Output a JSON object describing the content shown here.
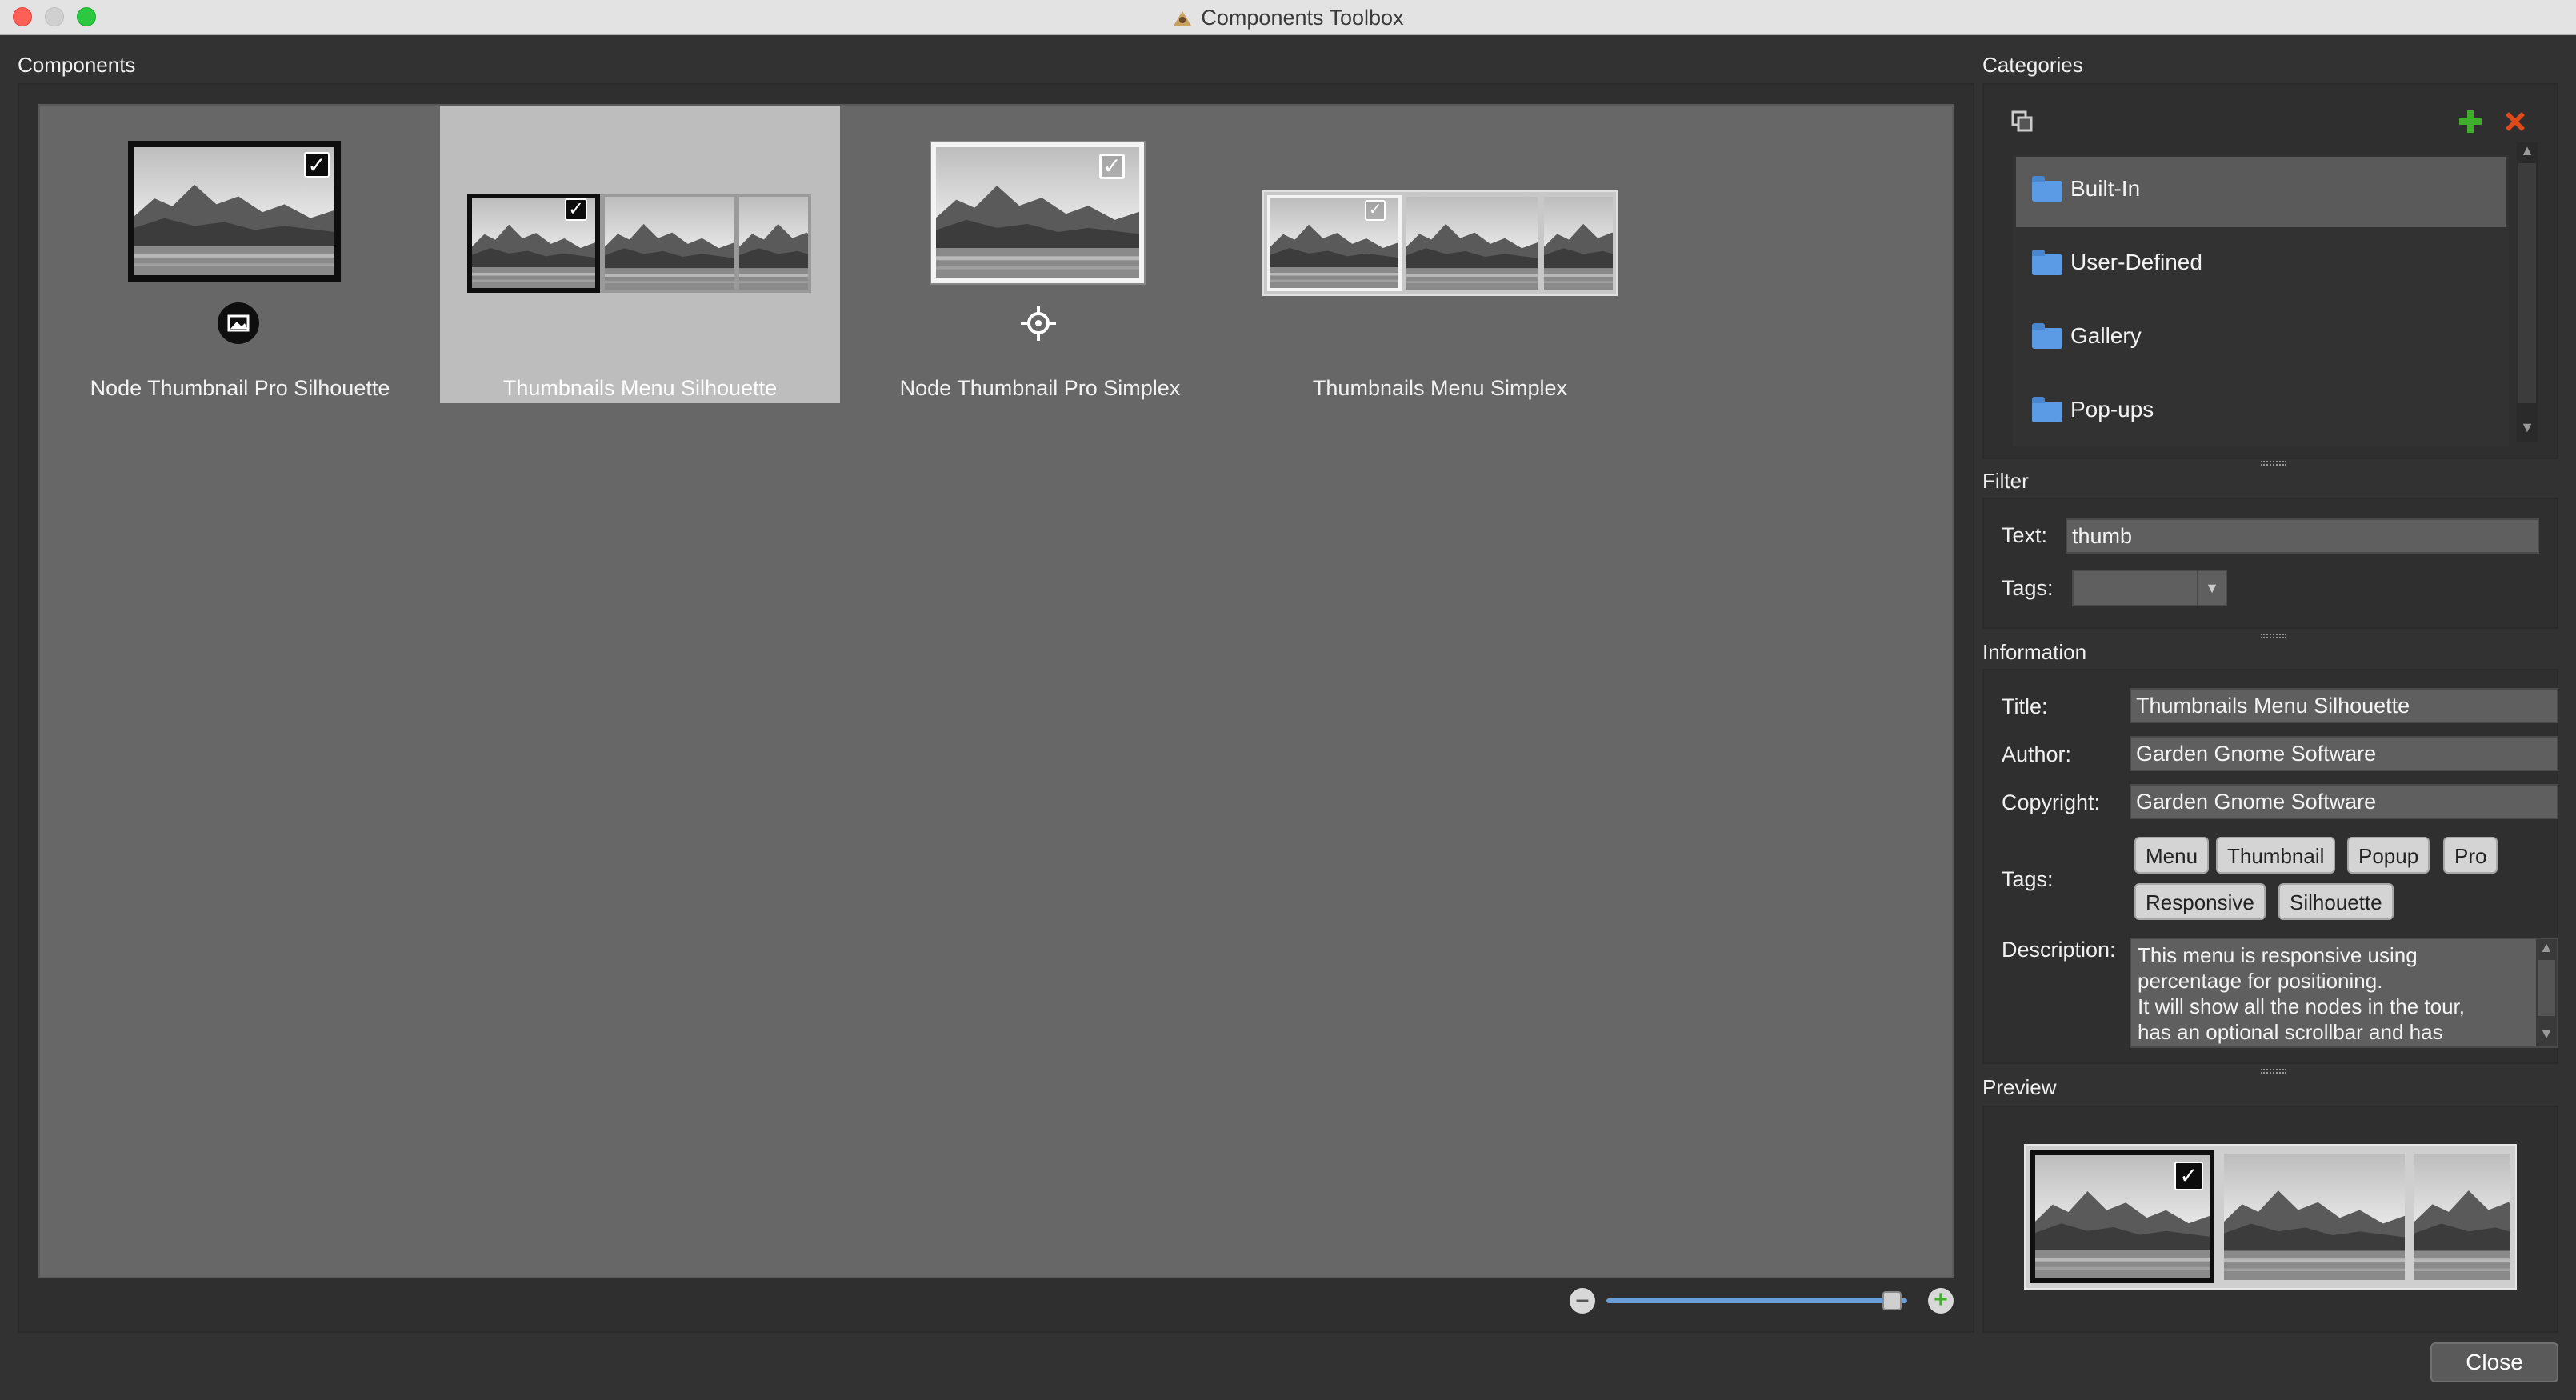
{
  "window": {
    "title": "Components Toolbox"
  },
  "components": {
    "header": "Components",
    "items": [
      {
        "label": "Node Thumbnail Pro Silhouette",
        "selected": false
      },
      {
        "label": "Thumbnails Menu Silhouette",
        "selected": true
      },
      {
        "label": "Node Thumbnail Pro Simplex",
        "selected": false
      },
      {
        "label": "Thumbnails Menu Simplex",
        "selected": false
      }
    ],
    "zoom": {
      "level": 0.95
    }
  },
  "categories": {
    "header": "Categories",
    "items": [
      {
        "label": "Built-In",
        "active": true
      },
      {
        "label": "User-Defined",
        "active": false
      },
      {
        "label": "Gallery",
        "active": false
      },
      {
        "label": "Pop-ups",
        "active": false
      }
    ]
  },
  "filter": {
    "header": "Filter",
    "text_label": "Text:",
    "text_value": "thumb",
    "tags_label": "Tags:",
    "tags_value": ""
  },
  "information": {
    "header": "Information",
    "title_label": "Title:",
    "title_value": "Thumbnails Menu Silhouette",
    "author_label": "Author:",
    "author_value": "Garden Gnome Software",
    "copyright_label": "Copyright:",
    "copyright_value": "Garden Gnome Software",
    "tags_label": "Tags:",
    "tags": [
      "Menu",
      "Thumbnail",
      "Popup",
      "Pro",
      "Responsive",
      "Silhouette"
    ],
    "description_label": "Description:",
    "description_lines": [
      "This menu is responsive using",
      "percentage for positioning.",
      "It will show all the nodes in the tour,",
      "has an optional scrollbar and has"
    ]
  },
  "preview": {
    "header": "Preview"
  },
  "footer": {
    "close_label": "Close"
  },
  "colors": {
    "accent_blue": "#5b9be6",
    "add_green": "#3fae2a",
    "remove_red": "#e04a1a"
  }
}
